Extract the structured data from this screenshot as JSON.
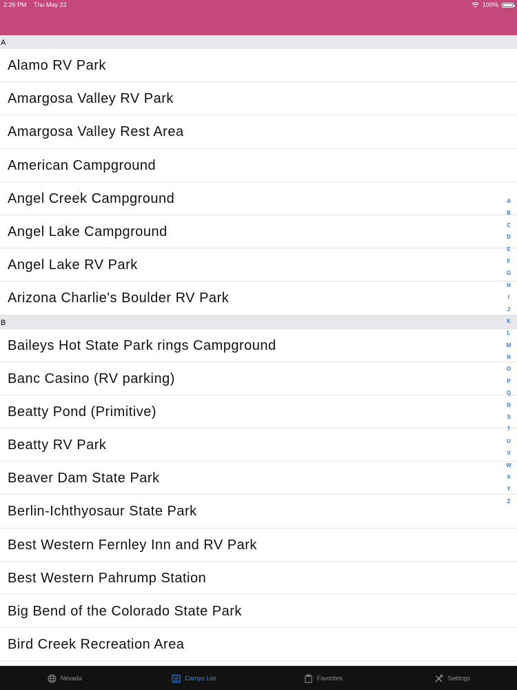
{
  "status_bar": {
    "time": "2:26 PM",
    "date": "Thu May 23",
    "battery": "100%"
  },
  "sections": [
    {
      "header": "A",
      "items": [
        "Alamo RV Park",
        "Amargosa Valley RV Park",
        "Amargosa Valley Rest Area",
        "American Campground",
        "Angel Creek Campground",
        "Angel Lake Campground",
        "Angel Lake RV Park",
        "Arizona Charlie's Boulder RV Park"
      ]
    },
    {
      "header": "B",
      "items": [
        "Baileys Hot State Park rings Campground",
        "Banc Casino (RV parking)",
        "Beatty Pond (Primitive)",
        "Beatty RV Park",
        "Beaver Dam State Park",
        "Berlin-Ichthyosaur State Park",
        "Best Western Fernley Inn and RV Park",
        "Best Western Pahrump Station",
        "Big Bend of the Colorado State Park",
        "Bird Creek Recreation Area"
      ]
    }
  ],
  "index_letters": [
    "A",
    "B",
    "C",
    "D",
    "E",
    "F",
    "G",
    "H",
    "I",
    "J",
    "K",
    "L",
    "M",
    "N",
    "O",
    "P",
    "Q",
    "R",
    "S",
    "T",
    "U",
    "V",
    "W",
    "X",
    "Y",
    "Z"
  ],
  "tabs": [
    {
      "label": "Nevada",
      "icon": "globe-icon",
      "active": false
    },
    {
      "label": "Camps List",
      "icon": "list-icon",
      "active": true
    },
    {
      "label": "Favorites",
      "icon": "clipboard-icon",
      "active": false
    },
    {
      "label": "Settings",
      "icon": "tools-icon",
      "active": false
    }
  ],
  "colors": {
    "nav_bar": "#c5487a",
    "tab_active": "#3b86f0",
    "tab_inactive": "#8f8f8f",
    "index_letters": "#2f7ee8"
  }
}
